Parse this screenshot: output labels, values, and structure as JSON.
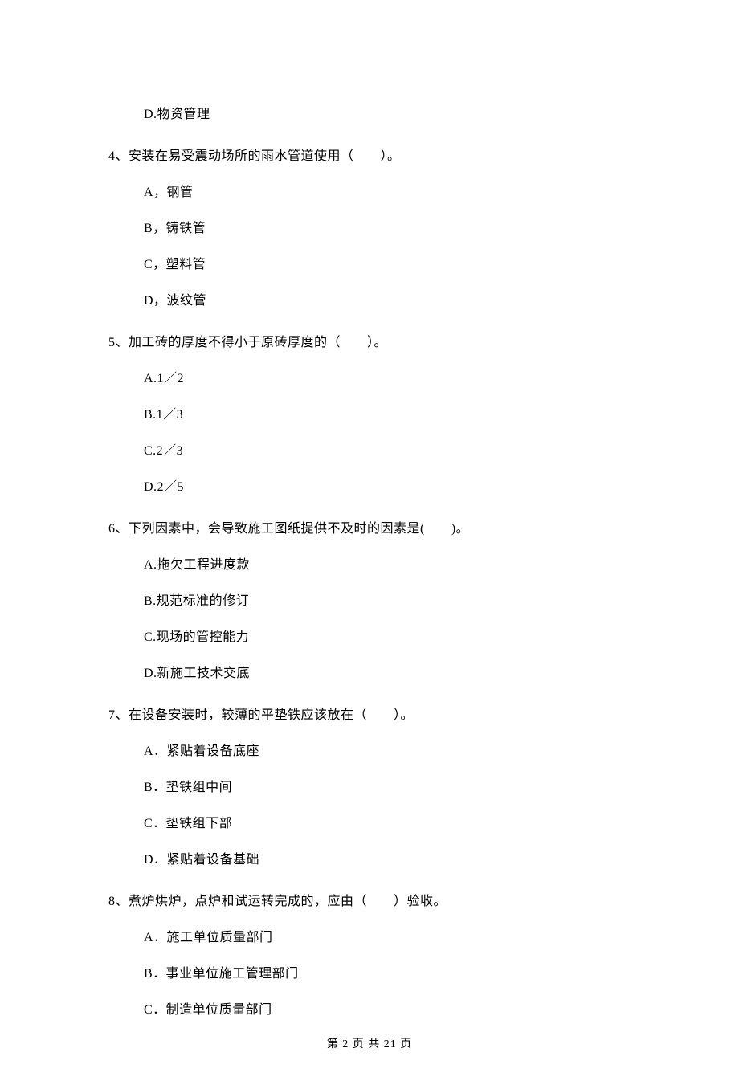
{
  "q3": {
    "optD": "D.物资管理"
  },
  "q4": {
    "stem": "4、安装在易受震动场所的雨水管道使用（　　）。",
    "optA": "A，钢管",
    "optB": "B，铸铁管",
    "optC": "C，塑料管",
    "optD": "D，波纹管"
  },
  "q5": {
    "stem": "5、加工砖的厚度不得小于原砖厚度的（　　）。",
    "optA": "A.1／2",
    "optB": "B.1／3",
    "optC": "C.2／3",
    "optD": "D.2／5"
  },
  "q6": {
    "stem": "6、下列因素中，会导致施工图纸提供不及时的因素是(　　)。",
    "optA": "A.拖欠工程进度款",
    "optB": "B.规范标准的修订",
    "optC": "C.现场的管控能力",
    "optD": "D.新施工技术交底"
  },
  "q7": {
    "stem": "7、在设备安装时，较薄的平垫铁应该放在（　　）。",
    "optA": "A．紧贴着设备底座",
    "optB": "B．垫铁组中间",
    "optC": "C．垫铁组下部",
    "optD": "D．紧贴着设备基础"
  },
  "q8": {
    "stem": "8、煮炉烘炉，点炉和试运转完成的，应由（　　）验收。",
    "optA": "A．施工单位质量部门",
    "optB": "B．事业单位施工管理部门",
    "optC": "C．制造单位质量部门"
  },
  "footer": "第 2 页 共 21 页"
}
